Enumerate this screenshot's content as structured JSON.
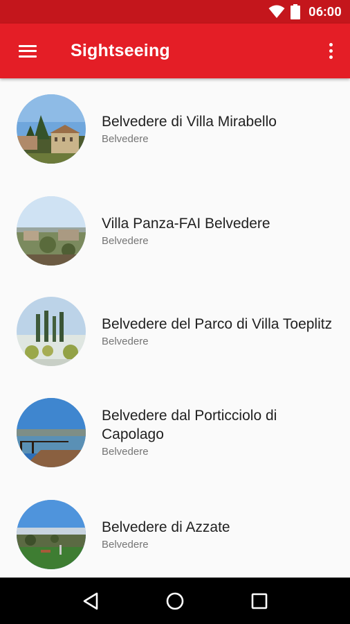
{
  "status_bar": {
    "time": "06:00",
    "icons": [
      "wifi-icon",
      "battery-icon"
    ]
  },
  "app_bar": {
    "title": "Sightseeing",
    "menu_icon": "menu-icon",
    "overflow_icon": "more-vert-icon"
  },
  "colors": {
    "primary": "#e41e26",
    "primary_dark": "#c4161c",
    "title_text": "#212121",
    "subtitle_text": "#757575"
  },
  "items": [
    {
      "title": "Belvedere di Villa Mirabello",
      "subtitle": "Belvedere"
    },
    {
      "title": "Villa Panza-FAI Belvedere",
      "subtitle": "Belvedere"
    },
    {
      "title": "Belvedere del Parco di Villa Toeplitz",
      "subtitle": "Belvedere"
    },
    {
      "title": "Belvedere dal Porticciolo di Capolago",
      "subtitle": "Belvedere"
    },
    {
      "title": "Belvedere di Azzate",
      "subtitle": "Belvedere"
    }
  ],
  "nav_bar": {
    "icons": [
      "back-icon",
      "home-icon",
      "recents-icon"
    ]
  }
}
